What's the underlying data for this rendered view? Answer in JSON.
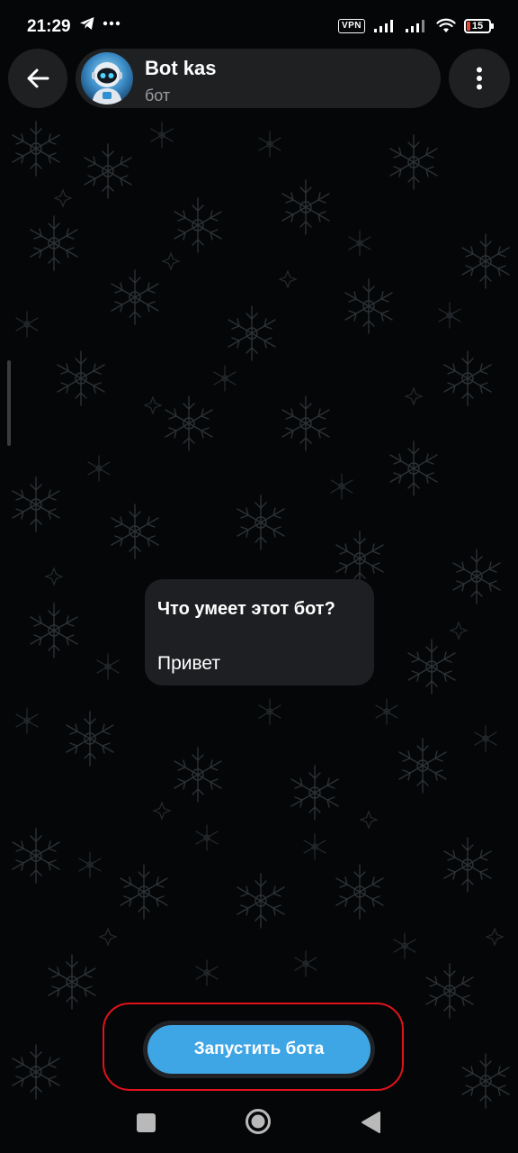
{
  "status_bar": {
    "time": "21:29",
    "vpn_label": "VPN",
    "battery_level": "15",
    "icons": [
      "telegram-icon",
      "more-notifications-icon",
      "cellular-signal-icon",
      "wifi-icon",
      "battery-icon"
    ]
  },
  "header": {
    "title": "Bot kas",
    "subtitle": "бот",
    "back_icon": "arrow-left-icon",
    "menu_icon": "more-vertical-icon",
    "avatar_icon": "robot-avatar"
  },
  "message": {
    "title": "Что умеет этот бот?",
    "text": "Привет"
  },
  "start_button": {
    "label": "Запустить бота"
  },
  "colors": {
    "accent": "#3fa6e5",
    "highlight": "#e0121b",
    "surface": "#1f2022",
    "background": "#050607"
  },
  "nav_bar": {
    "icons": [
      "recents-square-icon",
      "home-circle-icon",
      "back-triangle-icon"
    ]
  }
}
